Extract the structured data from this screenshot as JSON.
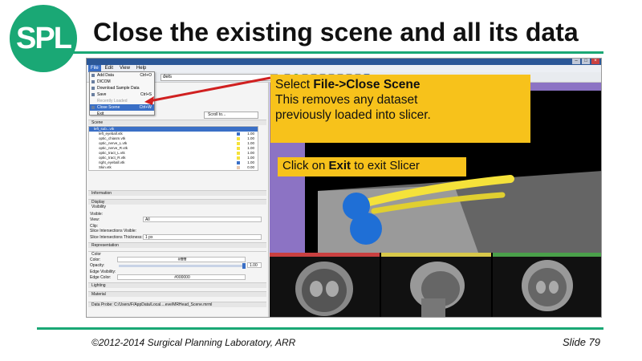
{
  "slide": {
    "logo_text": "SPL",
    "title": "Close the existing scene and all its data",
    "footer_left": "©2012-2014 Surgical Planning Laboratory, ARR",
    "footer_right": "Slide 79",
    "accent_color": "#1aa875",
    "callout_color": "#f7c21b"
  },
  "callouts": {
    "first_prefix": "Select ",
    "first_bold": "File->Close Scene",
    "first_line2": "This removes any dataset",
    "first_line3": "previously  loaded into slicer.",
    "second_prefix": "Click on ",
    "second_bold": "Exit",
    "second_suffix": " to exit Slicer"
  },
  "app": {
    "menubar": [
      "File",
      "Edit",
      "View",
      "Help"
    ],
    "module_combo": "dels",
    "file_menu": [
      {
        "label": "Add Data",
        "shortcut": "Ctrl+O"
      },
      {
        "label": "DICOM",
        "shortcut": ""
      },
      {
        "label": "Download Sample Data",
        "shortcut": ""
      },
      {
        "label": "Save",
        "shortcut": "Ctrl+S"
      },
      {
        "label": "Recently Loaded",
        "shortcut": ""
      },
      {
        "label": "Close Scene",
        "shortcut": "Ctrl+W"
      },
      {
        "label": "Exit",
        "shortcut": ""
      }
    ],
    "search_placeholder": "Scroll to...",
    "scene_header": "Scene",
    "tree_selected": "left_sub...vtk",
    "tree_items": [
      {
        "name": "left_eyeball.vtk",
        "color": "#3a6fc6",
        "opacity": "1.00"
      },
      {
        "name": "optic_chiasm.vtk",
        "color": "#f5e23a",
        "opacity": "1.00"
      },
      {
        "name": "optic_nerve_L.vtk",
        "color": "#f5e23a",
        "opacity": "1.00"
      },
      {
        "name": "optic_nerve_R.vtk",
        "color": "#f5e23a",
        "opacity": "1.00"
      },
      {
        "name": "optic_tract_L.vtk",
        "color": "#f5e23a",
        "opacity": "1.00"
      },
      {
        "name": "optic_tract_R.vtk",
        "color": "#f5e23a",
        "opacity": "1.00"
      },
      {
        "name": "right_eyeball.vtk",
        "color": "#3a6fc6",
        "opacity": "1.00"
      },
      {
        "name": "Skin.vtk",
        "color": "#e8c8b0",
        "opacity": "0.00"
      }
    ],
    "sections": {
      "information": "Information",
      "display": "Display",
      "visibility": "Visibility",
      "representation": "Representation",
      "color": "Color",
      "lighting": "Lighting",
      "material": "Material",
      "data_probe": "Data Probe: C:/Users/F/AppData/Local....eve/MRHead_Scene.mrml"
    },
    "props": {
      "visible": "Visible:",
      "view": "View:",
      "view_value": "All",
      "clip": "Clip:",
      "slice_vis": "Slice Intersections Visible:",
      "slice_thick": "Slice Intersections Thickness:",
      "slice_thick_value": "1 px",
      "color": "Color:",
      "color_value": "#ffffff",
      "opacity": "Opacity:",
      "opacity_value": "1.00",
      "edge_vis": "Edge Visibility:",
      "edge_color": "Edge Color:",
      "edge_color_value": "#000000"
    },
    "probe_lines": [
      "L",
      "F",
      "B"
    ],
    "view_label": "R",
    "slice_colors": [
      "#c94040",
      "#d8c84a",
      "#4aa04a"
    ]
  }
}
